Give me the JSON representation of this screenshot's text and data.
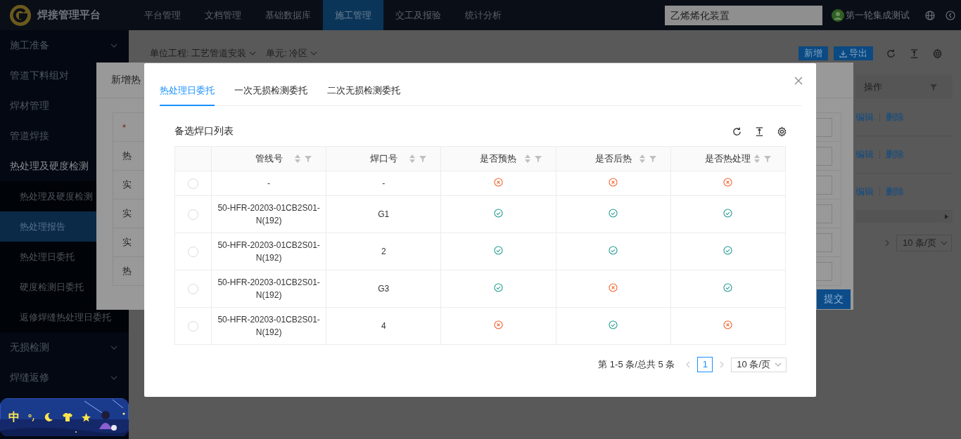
{
  "header": {
    "logo_text": "焊接管理平台",
    "nav": [
      {
        "label": "平台管理",
        "selected": false
      },
      {
        "label": "文档管理",
        "selected": false
      },
      {
        "label": "基础数据库",
        "selected": false
      },
      {
        "label": "施工管理",
        "selected": true
      },
      {
        "label": "交工及报验",
        "selected": false
      },
      {
        "label": "统计分析",
        "selected": false
      }
    ],
    "search": {
      "value": "乙烯烯化装置"
    },
    "user": "第一轮集成测试"
  },
  "sidebar": {
    "items": [
      {
        "label": "施工准备",
        "kind": "submenu",
        "expanded": false
      },
      {
        "label": "管道下料组对",
        "kind": "item",
        "expanded": false
      },
      {
        "label": "焊材管理",
        "kind": "item",
        "expanded": false
      },
      {
        "label": "管道焊接",
        "kind": "item",
        "expanded": false
      },
      {
        "label": "热处理及硬度检测",
        "kind": "item",
        "expanded": true,
        "children": [
          {
            "label": "热处理及硬度检测",
            "selected": false
          },
          {
            "label": "热处理报告",
            "selected": true
          },
          {
            "label": "热处理日委托",
            "selected": false
          },
          {
            "label": "硬度检测日委托",
            "selected": false
          },
          {
            "label": "返修焊缝热处理日委托",
            "selected": false
          }
        ]
      },
      {
        "label": "无损检测",
        "kind": "submenu",
        "expanded": false
      },
      {
        "label": "焊缝返修",
        "kind": "submenu",
        "expanded": false
      }
    ]
  },
  "ime_toolbar": {
    "language": "中"
  },
  "main": {
    "filters": [
      "单位工程: 工艺管道安装",
      "单元: 冷区"
    ],
    "buttons": [
      "新增",
      "导出"
    ],
    "table": {
      "columns": [
        "操作"
      ],
      "rows": [
        [
          "编辑",
          "删除"
        ],
        [
          "编辑",
          "删除"
        ],
        [
          "编辑",
          "删除"
        ]
      ]
    },
    "pagination": {
      "page_size": "10 条/页"
    }
  },
  "form_dialog": {
    "title": "新增热",
    "fields": [
      {
        "required_mark": "*"
      },
      {
        "label": "热"
      },
      {
        "label": "实"
      },
      {
        "label": "实"
      },
      {
        "label": "实"
      },
      {
        "label": "热"
      }
    ],
    "submit": "提交"
  },
  "dialog": {
    "tabs": [
      {
        "label": "热处理日委托",
        "selected": true
      },
      {
        "label": "一次无损检测委托",
        "selected": false
      },
      {
        "label": "二次无损检测委托",
        "selected": false
      }
    ],
    "title": "备选焊口列表",
    "columns": [
      "管线号",
      "焊口号",
      "是否预热",
      "是否后热",
      "是否热处理"
    ],
    "rows": [
      {
        "selected": false,
        "pipe": "-",
        "weld": "-",
        "preheat": false,
        "postheat": false,
        "heat_treatment": false
      },
      {
        "selected": false,
        "pipe": "50-HFR-20203-01CB2S01-N(192)",
        "weld": "G1",
        "preheat": true,
        "postheat": true,
        "heat_treatment": true
      },
      {
        "selected": false,
        "pipe": "50-HFR-20203-01CB2S01-N(192)",
        "weld": "2",
        "preheat": true,
        "postheat": true,
        "heat_treatment": true
      },
      {
        "selected": false,
        "pipe": "50-HFR-20203-01CB2S01-N(192)",
        "weld": "G3",
        "preheat": true,
        "postheat": false,
        "heat_treatment": true
      },
      {
        "selected": false,
        "pipe": "50-HFR-20203-01CB2S01-N(192)",
        "weld": "4",
        "preheat": false,
        "postheat": true,
        "heat_treatment": false
      }
    ],
    "pagination": {
      "summary": "第 1-5 条/总共 5 条",
      "pages": [
        {
          "label": "1",
          "selected": true
        }
      ],
      "page_size": "10 条/页"
    }
  }
}
